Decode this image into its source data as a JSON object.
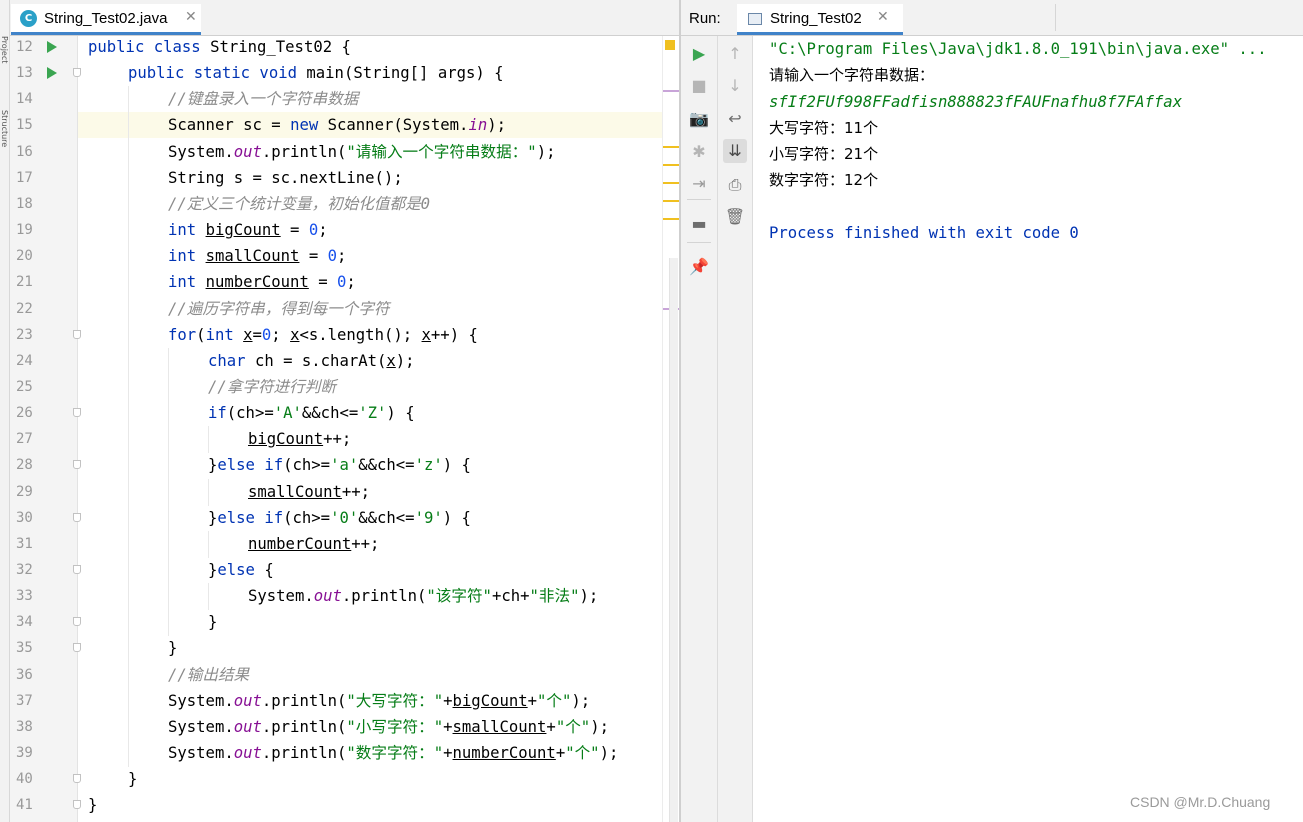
{
  "left_strip": {
    "labels": [
      "Project",
      "Structure"
    ]
  },
  "editor": {
    "tab": {
      "icon": "class-c-icon",
      "icon_letter": "C",
      "label": "String_Test02.java",
      "close": "✕"
    },
    "lines": [
      {
        "n": "12",
        "run": true,
        "fold": false,
        "indent": 0,
        "tokens": [
          [
            "kw",
            "public class "
          ],
          [
            "",
            "String_Test02 {"
          ]
        ]
      },
      {
        "n": "13",
        "run": true,
        "fold": true,
        "indent": 1,
        "tokens": [
          [
            "kw",
            "public static void "
          ],
          [
            "",
            "main(String[] args) {"
          ]
        ]
      },
      {
        "n": "14",
        "run": false,
        "fold": false,
        "indent": 2,
        "tokens": [
          [
            "com",
            "//键盘录入一个字符串数据"
          ]
        ]
      },
      {
        "n": "15",
        "run": false,
        "fold": false,
        "indent": 2,
        "tokens": [
          [
            "",
            "Scanner sc = "
          ],
          [
            "kw",
            "new "
          ],
          [
            "",
            "Scanner(System."
          ],
          [
            "fld",
            "in"
          ],
          [
            "",
            ");"
          ]
        ]
      },
      {
        "n": "16",
        "run": false,
        "fold": false,
        "indent": 2,
        "tokens": [
          [
            "",
            "System."
          ],
          [
            "fld",
            "out"
          ],
          [
            "",
            ".println("
          ],
          [
            "str",
            "\"请输入一个字符串数据：\""
          ],
          [
            "",
            ");"
          ]
        ]
      },
      {
        "n": "17",
        "run": false,
        "fold": false,
        "indent": 2,
        "tokens": [
          [
            "",
            "String s = sc.nextLine();"
          ]
        ]
      },
      {
        "n": "18",
        "run": false,
        "fold": false,
        "indent": 2,
        "tokens": [
          [
            "com",
            "//定义三个统计变量，初始化值都是0"
          ]
        ]
      },
      {
        "n": "19",
        "run": false,
        "fold": false,
        "indent": 2,
        "tokens": [
          [
            "kw",
            "int "
          ],
          [
            "und",
            "bigCount"
          ],
          [
            "",
            " = "
          ],
          [
            "num",
            "0"
          ],
          [
            "",
            ";"
          ]
        ]
      },
      {
        "n": "20",
        "run": false,
        "fold": false,
        "indent": 2,
        "tokens": [
          [
            "kw",
            "int "
          ],
          [
            "und",
            "smallCount"
          ],
          [
            "",
            " = "
          ],
          [
            "num",
            "0"
          ],
          [
            "",
            ";"
          ]
        ]
      },
      {
        "n": "21",
        "run": false,
        "fold": false,
        "indent": 2,
        "tokens": [
          [
            "kw",
            "int "
          ],
          [
            "und",
            "numberCount"
          ],
          [
            "",
            " = "
          ],
          [
            "num",
            "0"
          ],
          [
            "",
            ";"
          ]
        ]
      },
      {
        "n": "22",
        "run": false,
        "fold": false,
        "indent": 2,
        "tokens": [
          [
            "com",
            "//遍历字符串，得到每一个字符"
          ]
        ]
      },
      {
        "n": "23",
        "run": false,
        "fold": true,
        "indent": 2,
        "tokens": [
          [
            "kw",
            "for"
          ],
          [
            "",
            "("
          ],
          [
            "kw",
            "int "
          ],
          [
            "und",
            "x"
          ],
          [
            "",
            "="
          ],
          [
            "num",
            "0"
          ],
          [
            "",
            "; "
          ],
          [
            "und",
            "x"
          ],
          [
            "",
            "<s.length(); "
          ],
          [
            "und",
            "x"
          ],
          [
            "",
            "++) {"
          ]
        ]
      },
      {
        "n": "24",
        "run": false,
        "fold": false,
        "indent": 3,
        "tokens": [
          [
            "kw",
            "char "
          ],
          [
            "",
            "ch = s.charAt("
          ],
          [
            "und",
            "x"
          ],
          [
            "",
            ");"
          ]
        ]
      },
      {
        "n": "25",
        "run": false,
        "fold": false,
        "indent": 3,
        "tokens": [
          [
            "com",
            "//拿字符进行判断"
          ]
        ]
      },
      {
        "n": "26",
        "run": false,
        "fold": true,
        "indent": 3,
        "tokens": [
          [
            "kw",
            "if"
          ],
          [
            "",
            "(ch>="
          ],
          [
            "str",
            "'A'"
          ],
          [
            "",
            "&&ch<="
          ],
          [
            "str",
            "'Z'"
          ],
          [
            "",
            ") {"
          ]
        ]
      },
      {
        "n": "27",
        "run": false,
        "fold": false,
        "indent": 4,
        "tokens": [
          [
            "und",
            "bigCount"
          ],
          [
            "",
            "++;"
          ]
        ]
      },
      {
        "n": "28",
        "run": false,
        "fold": true,
        "indent": 3,
        "tokens": [
          [
            "",
            "}"
          ],
          [
            "kw",
            "else if"
          ],
          [
            "",
            "(ch>="
          ],
          [
            "str",
            "'a'"
          ],
          [
            "",
            "&&ch<="
          ],
          [
            "str",
            "'z'"
          ],
          [
            "",
            ") {"
          ]
        ]
      },
      {
        "n": "29",
        "run": false,
        "fold": false,
        "indent": 4,
        "tokens": [
          [
            "und",
            "smallCount"
          ],
          [
            "",
            "++;"
          ]
        ]
      },
      {
        "n": "30",
        "run": false,
        "fold": true,
        "indent": 3,
        "tokens": [
          [
            "",
            "}"
          ],
          [
            "kw",
            "else if"
          ],
          [
            "",
            "(ch>="
          ],
          [
            "str",
            "'0'"
          ],
          [
            "",
            "&&ch<="
          ],
          [
            "str",
            "'9'"
          ],
          [
            "",
            ") {"
          ]
        ]
      },
      {
        "n": "31",
        "run": false,
        "fold": false,
        "indent": 4,
        "tokens": [
          [
            "und",
            "numberCount"
          ],
          [
            "",
            "++;"
          ]
        ]
      },
      {
        "n": "32",
        "run": false,
        "fold": true,
        "indent": 3,
        "tokens": [
          [
            "",
            "}"
          ],
          [
            "kw",
            "else "
          ],
          [
            "",
            "{"
          ]
        ]
      },
      {
        "n": "33",
        "run": false,
        "fold": false,
        "indent": 4,
        "tokens": [
          [
            "",
            "System."
          ],
          [
            "fld",
            "out"
          ],
          [
            "",
            ".println("
          ],
          [
            "str",
            "\"该字符\""
          ],
          [
            "",
            "+ch+"
          ],
          [
            "str",
            "\"非法\""
          ],
          [
            "",
            ");"
          ]
        ]
      },
      {
        "n": "34",
        "run": false,
        "fold": true,
        "indent": 3,
        "tokens": [
          [
            "",
            "}"
          ]
        ]
      },
      {
        "n": "35",
        "run": false,
        "fold": true,
        "indent": 2,
        "tokens": [
          [
            "",
            "}"
          ]
        ]
      },
      {
        "n": "36",
        "run": false,
        "fold": false,
        "indent": 2,
        "tokens": [
          [
            "com",
            "//输出结果"
          ]
        ]
      },
      {
        "n": "37",
        "run": false,
        "fold": false,
        "indent": 2,
        "tokens": [
          [
            "",
            "System."
          ],
          [
            "fld",
            "out"
          ],
          [
            "",
            ".println("
          ],
          [
            "str",
            "\"大写字符：\""
          ],
          [
            "",
            "+"
          ],
          [
            "und",
            "bigCount"
          ],
          [
            "",
            "+"
          ],
          [
            "str",
            "\"个\""
          ],
          [
            "",
            ");"
          ]
        ]
      },
      {
        "n": "38",
        "run": false,
        "fold": false,
        "indent": 2,
        "tokens": [
          [
            "",
            "System."
          ],
          [
            "fld",
            "out"
          ],
          [
            "",
            ".println("
          ],
          [
            "str",
            "\"小写字符：\""
          ],
          [
            "",
            "+"
          ],
          [
            "und",
            "smallCount"
          ],
          [
            "",
            "+"
          ],
          [
            "str",
            "\"个\""
          ],
          [
            "",
            ");"
          ]
        ]
      },
      {
        "n": "39",
        "run": false,
        "fold": false,
        "indent": 2,
        "tokens": [
          [
            "",
            "System."
          ],
          [
            "fld",
            "out"
          ],
          [
            "",
            ".println("
          ],
          [
            "str",
            "\"数字字符：\""
          ],
          [
            "",
            "+"
          ],
          [
            "und",
            "numberCount"
          ],
          [
            "",
            "+"
          ],
          [
            "str",
            "\"个\""
          ],
          [
            "",
            ");"
          ]
        ]
      },
      {
        "n": "40",
        "run": false,
        "fold": true,
        "indent": 1,
        "tokens": [
          [
            "",
            "}"
          ]
        ]
      },
      {
        "n": "41",
        "run": false,
        "fold": true,
        "indent": 0,
        "tokens": [
          [
            "",
            "}"
          ]
        ]
      }
    ],
    "highlighted_line": "15",
    "marker_colors": {
      "warning": "#f0c020",
      "info": "#c8a4d8"
    }
  },
  "run_panel": {
    "label": "Run:",
    "tab": {
      "label": "String_Test02",
      "icon": "console-icon",
      "close": "✕"
    },
    "toolbar1": [
      {
        "name": "rerun-icon",
        "glyph": "▶",
        "color": "#3aa551"
      },
      {
        "name": "stop-icon",
        "glyph": "■",
        "color": "#b5b5b5"
      },
      {
        "name": "camera-icon",
        "glyph": "📷",
        "color": "#9a9a9a"
      },
      {
        "name": "debug-bug-icon",
        "glyph": "✱",
        "color": "#b5b5b5"
      },
      {
        "name": "login-icon",
        "glyph": "⇥",
        "color": "#9a9a9a"
      },
      {
        "name": "layout-icon",
        "glyph": "▬",
        "color": "#6e6e6e"
      },
      {
        "name": "pin-icon",
        "glyph": "📌",
        "color": "#8a8a8a"
      }
    ],
    "toolbar2": [
      {
        "name": "scroll-up-icon",
        "glyph": "↑",
        "color": "#b5b5b5"
      },
      {
        "name": "scroll-down-icon",
        "glyph": "↓",
        "color": "#b5b5b5"
      },
      {
        "name": "soft-wrap-icon",
        "glyph": "↩",
        "color": "#6e6e6e"
      },
      {
        "name": "scroll-to-end-icon",
        "glyph": "⇊",
        "color": "#4a4a4a"
      },
      {
        "name": "print-icon",
        "glyph": "⎙",
        "color": "#6e6e6e"
      },
      {
        "name": "trash-icon",
        "glyph": "🗑",
        "color": "#6e6e6e"
      }
    ],
    "console": {
      "command": "\"C:\\Program Files\\Java\\jdk1.8.0_191\\bin\\java.exe\" ...",
      "prompt": "请输入一个字符串数据：",
      "user_input": "sfIf2FUf998FFadfisn888823fFAUFnafhu8f7FAffax",
      "upper": "大写字符：11个",
      "lower": "小写字符：21个",
      "digits": "数字字符：12个",
      "exit": "Process finished with exit code 0"
    }
  },
  "watermark": "CSDN @Mr.D.Chuang"
}
